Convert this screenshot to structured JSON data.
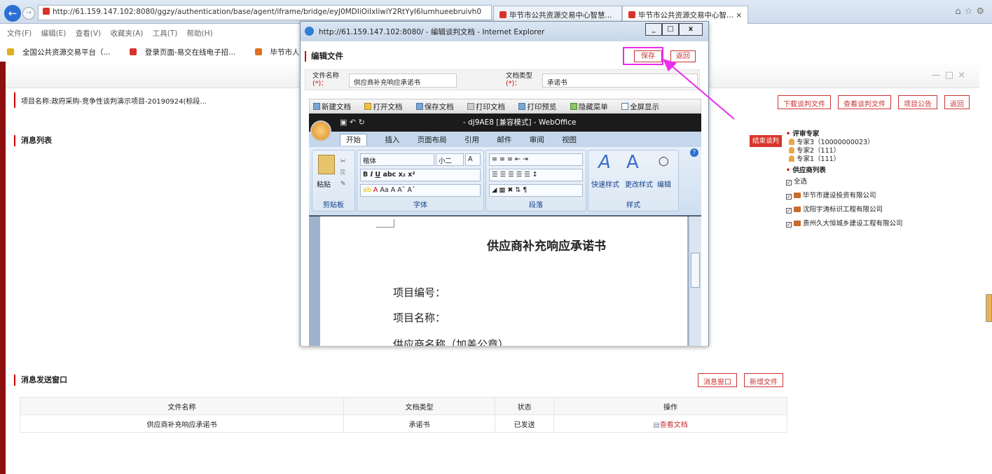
{
  "browser": {
    "address": "http://61.159.147.102:8080/ggzy/authentication/base/agent/iframe/bridge/eyJ0MDIiOiIxIiwiY2RtYyI6Iumhueebruivh0",
    "address_host": "61.159.147.102",
    "tabs": [
      "毕节市公共资源交易中心智慧...",
      "毕节市公共资源交易中心智..."
    ],
    "menu": [
      "文件(F)",
      "编辑(E)",
      "查看(V)",
      "收藏夹(A)",
      "工具(T)",
      "帮助(H)"
    ],
    "favorites": [
      "全国公共资源交易平台（...",
      "登录页面-易交在线电子招...",
      "毕节市人民政府"
    ]
  },
  "page": {
    "project": "项目名称:政府采购-竞争性谈判演示项目-20190924(标段...",
    "top_buttons": [
      "下载谈判文件",
      "查看谈判文件",
      "项目公告",
      "返回"
    ],
    "message_list_title": "消息列表",
    "end_btn": "结束谈判",
    "experts_title": "评审专家",
    "experts": [
      "专家3（10000000023）",
      "专家2（111）",
      "专家1（111）"
    ],
    "suppliers_title": "供应商列表",
    "select_all": "全选",
    "suppliers": [
      "毕节市建设投资有限公司",
      "沈阳宇涛标识工程有限公司",
      "贵州久大恒城乡建设工程有限公司"
    ],
    "send_title": "消息发送窗口",
    "send_buttons": [
      "消息窗口",
      "新增文件"
    ],
    "table_headers": [
      "文件名称",
      "文档类型",
      "状态",
      "操作"
    ],
    "table_rows": [
      {
        "name": "供应商补充响应承诺书",
        "type": "承诺书",
        "status": "已发送",
        "action": "查看文档"
      }
    ]
  },
  "popup": {
    "title": "http://61.159.147.102:8080/ - 编辑谈判文档 - Internet Explorer",
    "heading": "编辑文件",
    "save": "保存",
    "back": "返回",
    "file_name_label": "文件名称",
    "file_name_req": "(*)：",
    "file_name": "供应商补充响应承诺书",
    "doc_type_label": "文档类型",
    "doc_type_req": "(*)：",
    "doc_type": "承诺书",
    "toolbar": [
      "新建文档",
      "打开文档",
      "保存文档",
      "打印文档",
      "打印预览",
      "隐藏菜单",
      "全屏显示"
    ],
    "word_title": "- dj9AE8 [兼容模式] - WebOffice",
    "ribbon_tabs": [
      "开始",
      "插入",
      "页面布局",
      "引用",
      "邮件",
      "审阅",
      "视图"
    ],
    "ribbon": {
      "paste": "粘贴",
      "font": "楷体",
      "size": "小二",
      "quick_style": "快速样式",
      "change_style": "更改样式",
      "edit": "编辑",
      "groups": [
        "剪贴板",
        "字体",
        "段落",
        "样式"
      ]
    },
    "doc": {
      "title": "供应商补充响应承诺书",
      "line1": "项目编号：",
      "line2": "项目名称：",
      "line3": "供应商名称（加盖公章）"
    }
  }
}
